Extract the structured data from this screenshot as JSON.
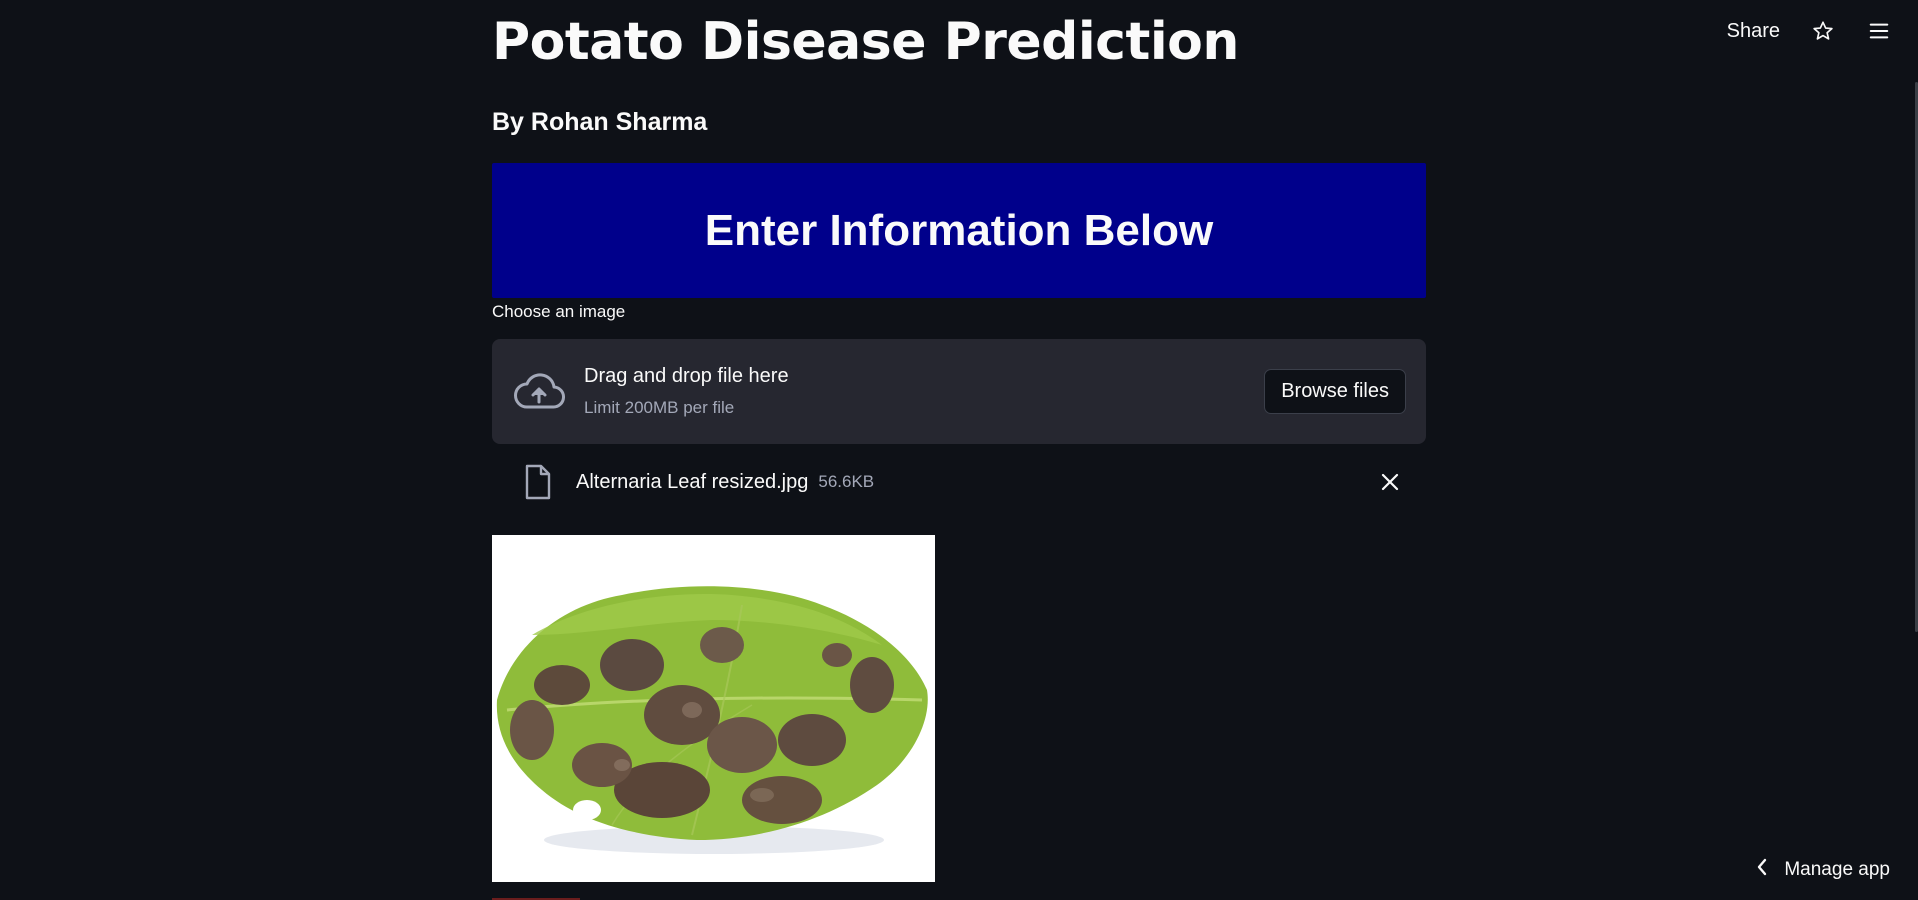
{
  "toolbar": {
    "share_label": "Share",
    "star_icon": "star-icon",
    "menu_icon": "hamburger-menu-icon"
  },
  "header": {
    "title": "Potato Disease Prediction",
    "byline": "By Rohan Sharma"
  },
  "banner": {
    "text": "Enter Information Below",
    "background": "#00008b"
  },
  "uploader": {
    "label": "Choose an image",
    "drop_text": "Drag and drop file here",
    "limit_text": "Limit 200MB per file",
    "browse_label": "Browse files",
    "icon": "cloud-upload-icon"
  },
  "uploaded_file": {
    "name": "Alternaria Leaf resized.jpg",
    "size": "56.6KB",
    "icon": "file-icon",
    "remove_icon": "close-icon"
  },
  "preview": {
    "image": "potato-leaf-image"
  },
  "footer": {
    "manage_label": "Manage app",
    "icon": "chevron-left-icon"
  },
  "colors": {
    "background": "#0e1117",
    "surface": "#262730",
    "text": "#fafafa",
    "muted": "#a3a8b8"
  }
}
